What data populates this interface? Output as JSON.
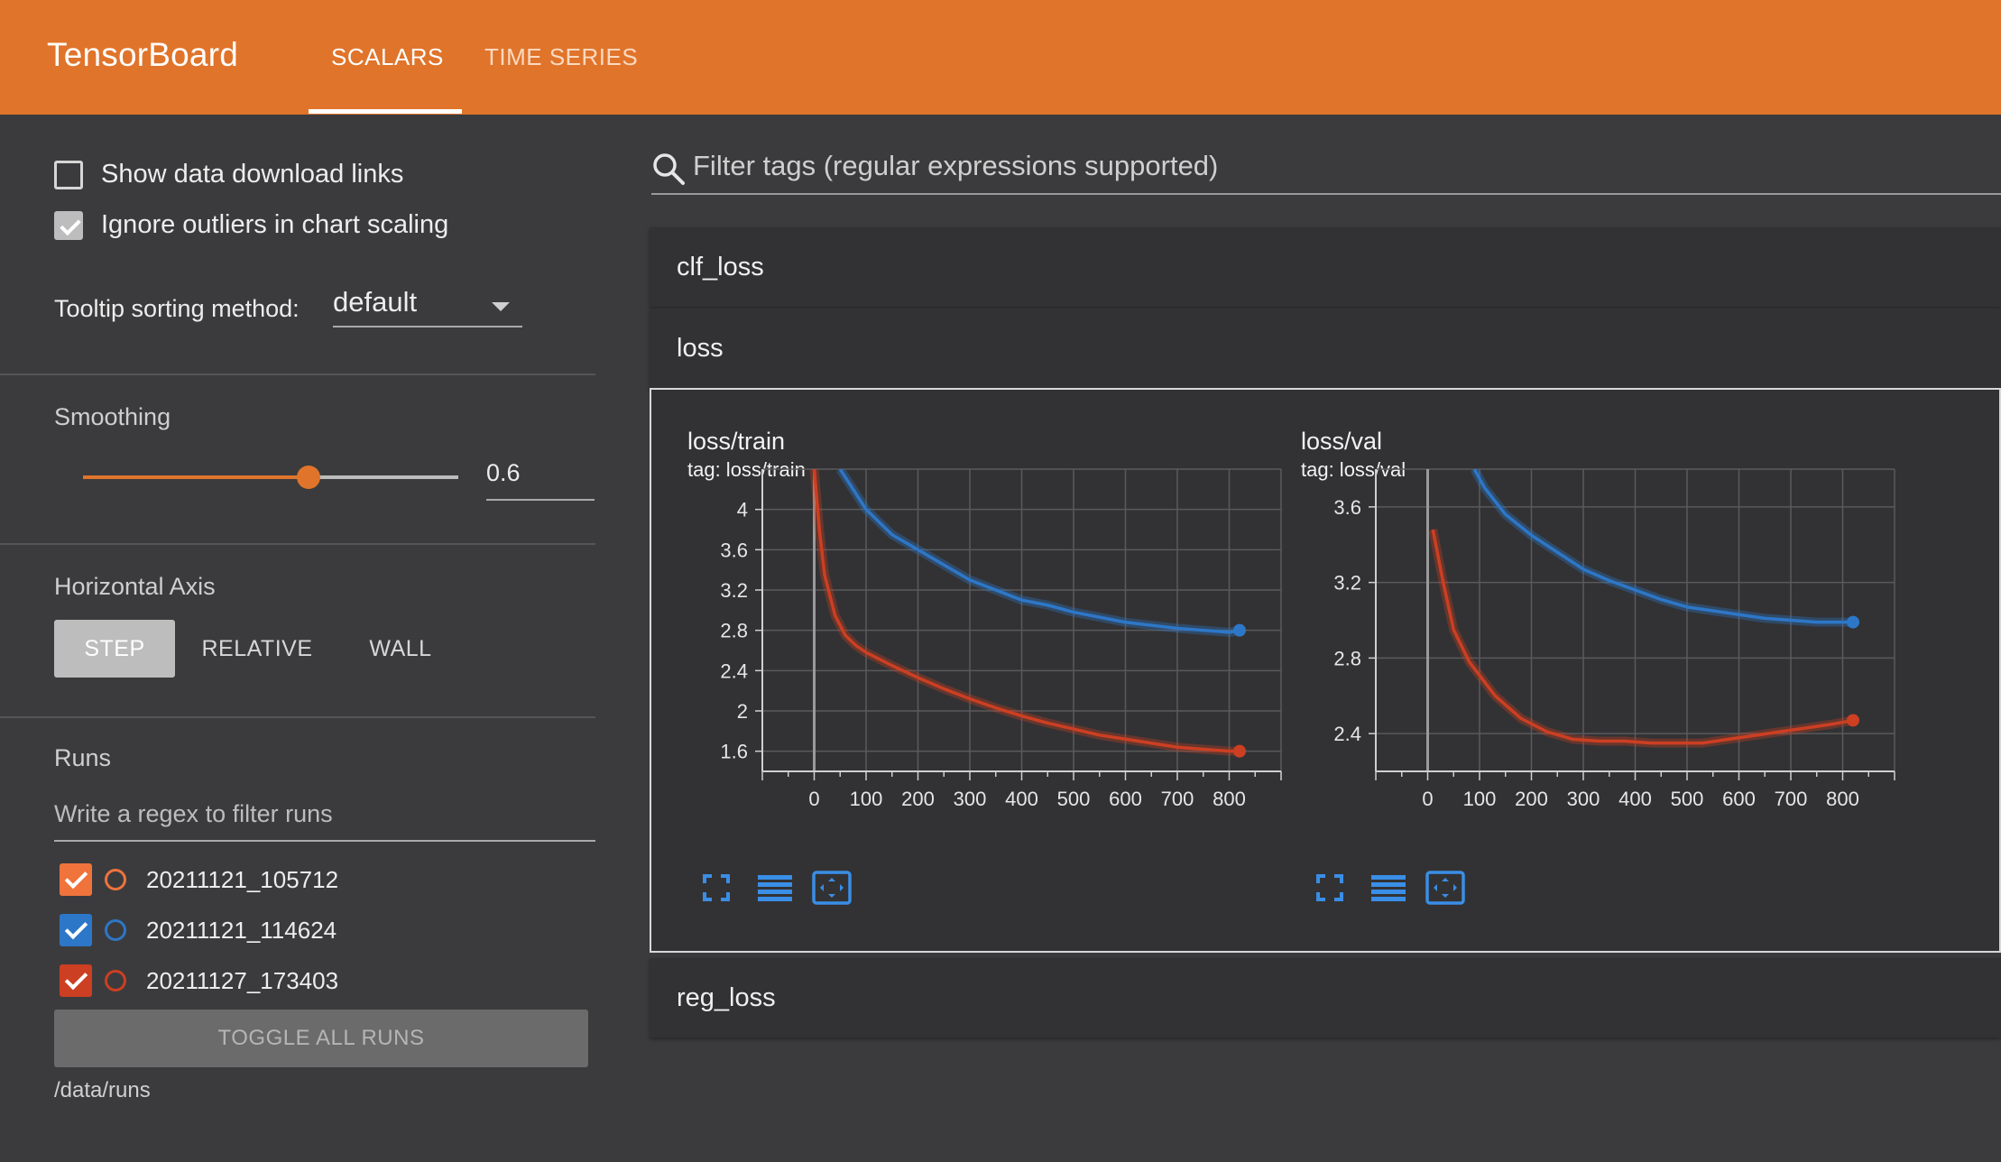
{
  "app": {
    "title": "TensorBoard",
    "tabs": [
      {
        "label": "SCALARS",
        "active": true
      },
      {
        "label": "TIME SERIES",
        "active": false
      }
    ],
    "accent": "#e0742b"
  },
  "sidebar": {
    "show_download_links": {
      "label": "Show data download links",
      "checked": false
    },
    "ignore_outliers": {
      "label": "Ignore outliers in chart scaling",
      "checked": true
    },
    "tooltip_sorting": {
      "label": "Tooltip sorting method:",
      "value": "default"
    },
    "smoothing": {
      "title": "Smoothing",
      "value": "0.6",
      "fraction": 0.6
    },
    "horizontal_axis": {
      "title": "Horizontal Axis",
      "options": [
        "STEP",
        "RELATIVE",
        "WALL"
      ],
      "selected": "STEP"
    },
    "runs": {
      "title": "Runs",
      "filter_placeholder": "Write a regex to filter runs",
      "items": [
        {
          "name": "20211121_105712",
          "checked": true,
          "color": "#f0733c"
        },
        {
          "name": "20211121_114624",
          "checked": true,
          "color": "#2d77c8"
        },
        {
          "name": "20211127_173403",
          "checked": true,
          "color": "#cc3f22"
        }
      ],
      "toggle_all_label": "TOGGLE ALL RUNS",
      "logdir": "/data/runs"
    }
  },
  "main": {
    "filter_placeholder": "Filter tags (regular expressions supported)",
    "groups": [
      "clf_loss",
      "loss",
      "reg_loss"
    ],
    "toolbar_icons": [
      "fullscreen-icon",
      "toggle-log-scale-icon",
      "fit-domain-icon"
    ]
  },
  "chart_data": [
    {
      "type": "line",
      "title": "loss/train",
      "subtitle": "tag: loss/train",
      "xlabel": "",
      "ylabel": "",
      "xlim": [
        -100,
        900
      ],
      "ylim": [
        1.4,
        4.4
      ],
      "xticks": [
        0,
        100,
        200,
        300,
        400,
        500,
        600,
        700,
        800
      ],
      "yticks": [
        1.6,
        2,
        2.4,
        2.8,
        3.2,
        3.6,
        4
      ],
      "grid": true,
      "series": [
        {
          "color": "#2d77c8",
          "x": [
            50,
            100,
            150,
            200,
            250,
            300,
            350,
            400,
            450,
            500,
            550,
            600,
            650,
            700,
            750,
            800,
            820
          ],
          "y": [
            4.4,
            4.0,
            3.75,
            3.6,
            3.45,
            3.3,
            3.2,
            3.1,
            3.05,
            2.98,
            2.93,
            2.88,
            2.85,
            2.82,
            2.8,
            2.78,
            2.8
          ]
        },
        {
          "color": "#cc3f22",
          "x": [
            0,
            10,
            20,
            40,
            60,
            80,
            100,
            150,
            200,
            250,
            300,
            350,
            400,
            450,
            500,
            550,
            600,
            650,
            700,
            750,
            800,
            820
          ],
          "y": [
            4.4,
            3.8,
            3.35,
            2.95,
            2.75,
            2.65,
            2.58,
            2.45,
            2.33,
            2.22,
            2.12,
            2.03,
            1.95,
            1.88,
            1.82,
            1.76,
            1.72,
            1.68,
            1.64,
            1.62,
            1.6,
            1.6
          ]
        }
      ]
    },
    {
      "type": "line",
      "title": "loss/val",
      "subtitle": "tag: loss/val",
      "xlabel": "",
      "ylabel": "",
      "xlim": [
        -100,
        900
      ],
      "ylim": [
        2.2,
        3.8
      ],
      "xticks": [
        0,
        100,
        200,
        300,
        400,
        500,
        600,
        700,
        800
      ],
      "yticks": [
        2.4,
        2.8,
        3.2,
        3.6
      ],
      "grid": true,
      "series": [
        {
          "color": "#2d77c8",
          "x": [
            90,
            110,
            150,
            200,
            250,
            300,
            350,
            400,
            450,
            500,
            550,
            600,
            650,
            700,
            750,
            820
          ],
          "y": [
            3.8,
            3.7,
            3.56,
            3.45,
            3.36,
            3.27,
            3.21,
            3.16,
            3.11,
            3.07,
            3.05,
            3.03,
            3.01,
            3.0,
            2.99,
            2.99
          ]
        },
        {
          "color": "#cc3f22",
          "x": [
            10,
            30,
            50,
            80,
            130,
            180,
            230,
            280,
            330,
            380,
            430,
            480,
            530,
            580,
            630,
            680,
            730,
            780,
            820
          ],
          "y": [
            3.48,
            3.2,
            2.95,
            2.78,
            2.6,
            2.48,
            2.41,
            2.37,
            2.36,
            2.36,
            2.35,
            2.35,
            2.35,
            2.37,
            2.39,
            2.41,
            2.43,
            2.45,
            2.47
          ]
        }
      ]
    }
  ]
}
